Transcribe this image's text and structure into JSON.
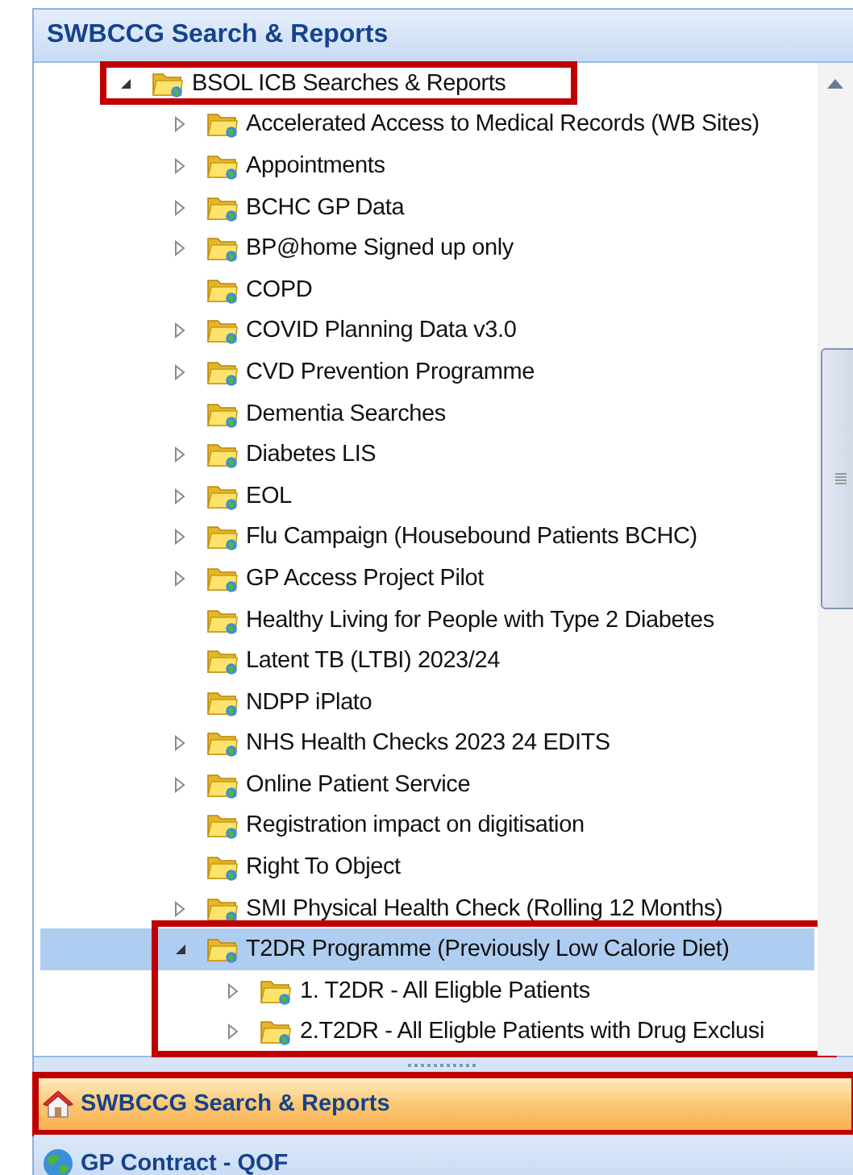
{
  "panel": {
    "title": "SWBCCG Search & Reports"
  },
  "tree": [
    {
      "label": "BSOL ICB Searches & Reports",
      "expandable": true,
      "expanded": true,
      "selected": false,
      "annotated": true,
      "children": [
        {
          "label": "Accelerated Access to Medical Records (WB Sites)",
          "expandable": true,
          "expanded": false,
          "selected": false,
          "annotated": false
        },
        {
          "label": "Appointments",
          "expandable": true,
          "expanded": false,
          "selected": false,
          "annotated": false
        },
        {
          "label": "BCHC GP Data",
          "expandable": true,
          "expanded": false,
          "selected": false,
          "annotated": false
        },
        {
          "label": "BP@home Signed up only",
          "expandable": true,
          "expanded": false,
          "selected": false,
          "annotated": false
        },
        {
          "label": "COPD",
          "expandable": false,
          "expanded": false,
          "selected": false,
          "annotated": false
        },
        {
          "label": "COVID Planning Data v3.0",
          "expandable": true,
          "expanded": false,
          "selected": false,
          "annotated": false
        },
        {
          "label": "CVD Prevention Programme",
          "expandable": true,
          "expanded": false,
          "selected": false,
          "annotated": false
        },
        {
          "label": "Dementia Searches",
          "expandable": false,
          "expanded": false,
          "selected": false,
          "annotated": false
        },
        {
          "label": "Diabetes LIS",
          "expandable": true,
          "expanded": false,
          "selected": false,
          "annotated": false
        },
        {
          "label": "EOL",
          "expandable": true,
          "expanded": false,
          "selected": false,
          "annotated": false
        },
        {
          "label": "Flu Campaign (Housebound Patients BCHC)",
          "expandable": true,
          "expanded": false,
          "selected": false,
          "annotated": false
        },
        {
          "label": "GP Access Project Pilot",
          "expandable": true,
          "expanded": false,
          "selected": false,
          "annotated": false
        },
        {
          "label": "Healthy Living for People with Type 2 Diabetes",
          "expandable": false,
          "expanded": false,
          "selected": false,
          "annotated": false
        },
        {
          "label": "Latent TB (LTBI) 2023/24",
          "expandable": false,
          "expanded": false,
          "selected": false,
          "annotated": false
        },
        {
          "label": "NDPP iPlato",
          "expandable": false,
          "expanded": false,
          "selected": false,
          "annotated": false
        },
        {
          "label": "NHS Health Checks 2023 24 EDITS",
          "expandable": true,
          "expanded": false,
          "selected": false,
          "annotated": false
        },
        {
          "label": "Online Patient Service",
          "expandable": true,
          "expanded": false,
          "selected": false,
          "annotated": false
        },
        {
          "label": "Registration impact on digitisation",
          "expandable": false,
          "expanded": false,
          "selected": false,
          "annotated": false
        },
        {
          "label": "Right To Object",
          "expandable": false,
          "expanded": false,
          "selected": false,
          "annotated": false
        },
        {
          "label": "SMI Physical Health Check (Rolling 12 Months)",
          "expandable": true,
          "expanded": false,
          "selected": false,
          "annotated": false
        },
        {
          "label": "T2DR Programme (Previously Low Calorie Diet)",
          "expandable": true,
          "expanded": true,
          "selected": true,
          "annotated": true,
          "children": [
            {
              "label": "1. T2DR - All Eligble Patients",
              "expandable": true,
              "expanded": false,
              "selected": false,
              "annotated": false
            },
            {
              "label": "2.T2DR - All Eligble Patients with Drug Exclusi",
              "expandable": true,
              "expanded": false,
              "selected": false,
              "annotated": false
            }
          ]
        }
      ]
    }
  ],
  "nav": [
    {
      "label": "SWBCCG Search & Reports",
      "kind": "house",
      "selected": true,
      "annotated": true
    },
    {
      "label": "GP Contract - QOF",
      "kind": "globe",
      "selected": false,
      "annotated": false
    }
  ]
}
